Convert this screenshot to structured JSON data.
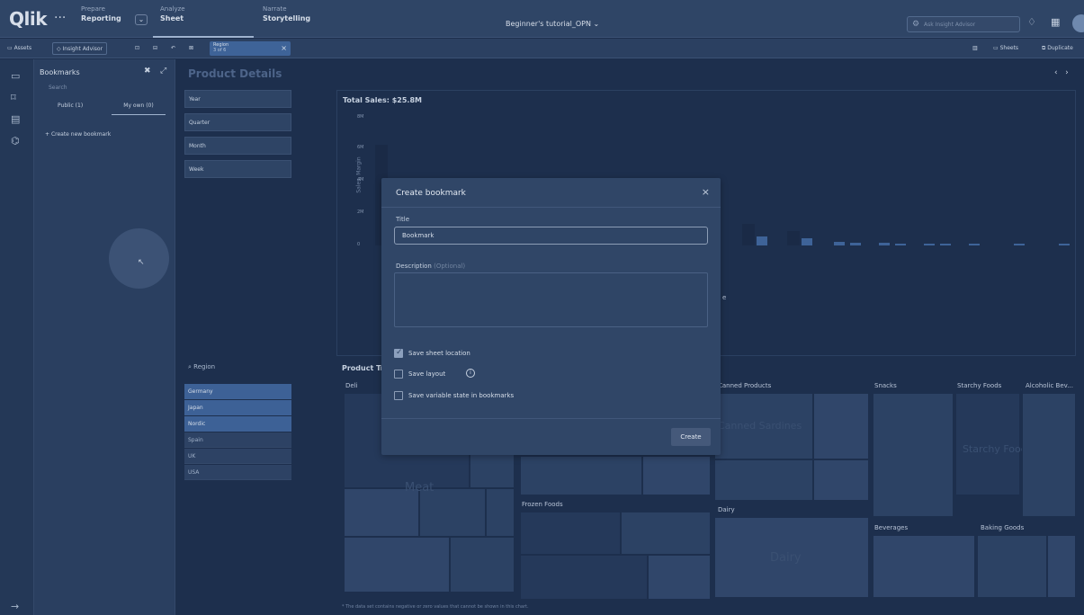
{
  "header": {
    "logo": "Qlik",
    "more_menu": "···",
    "nav": [
      {
        "small": "Prepare",
        "big": "Reporting"
      },
      {
        "small": "Analyze",
        "big": "Sheet"
      },
      {
        "small": "Narrate",
        "big": "Storytelling"
      }
    ],
    "app_title": "Beginner's tutorial_OPN ⌄",
    "search_placeholder": "Ask Insight Advisor"
  },
  "toolbar": {
    "assets": "Assets",
    "insight_advisor": "Insight Advisor",
    "region_chip": {
      "field": "Region",
      "value": "3 of 6"
    },
    "sheets": "Sheets",
    "duplicate": "Duplicate"
  },
  "bookmarks": {
    "title": "Bookmarks",
    "search_placeholder": "Search",
    "tabs": [
      "Public (1)",
      "My own (0)"
    ],
    "create_label": "Create new bookmark"
  },
  "sheet": {
    "title": "Product Details",
    "filters": [
      "Year",
      "Quarter",
      "Month",
      "Week"
    ],
    "region_label": "Region",
    "regions_selected": [
      "Germany",
      "Japan",
      "Nordic"
    ],
    "regions_other": [
      "Spain",
      "UK",
      "USA"
    ]
  },
  "chart1": {
    "title": "Total Sales: $25.8M",
    "ylabel": "Sales, Margin",
    "yticks": [
      "8M",
      "6M",
      "4M",
      "2M",
      "0"
    ],
    "x_label_fragment": "e"
  },
  "chart2": {
    "title_fragment": "Product Tr",
    "categories": [
      "Deli",
      "Canned Products",
      "Snacks",
      "Starchy Foods",
      "Alcoholic Bev...",
      "Frozen Foods",
      "Dairy",
      "Beverages",
      "Baking Goods"
    ],
    "big_labels": [
      "Meat",
      "Canned Sardines",
      "Dairy",
      "Starchy Foods"
    ],
    "footnote": "* The data set contains negative or zero values that cannot be shown in this chart."
  },
  "modal": {
    "title": "Create bookmark",
    "close": "×",
    "title_label": "Title",
    "title_value": "Bookmark",
    "description_label": "Description",
    "description_optional": "(Optional)",
    "options": [
      {
        "label": "Save sheet location",
        "checked": true
      },
      {
        "label": "Save layout",
        "checked": false
      },
      {
        "label": "Save variable state in bookmarks",
        "checked": false
      }
    ],
    "create_label": "Create"
  }
}
